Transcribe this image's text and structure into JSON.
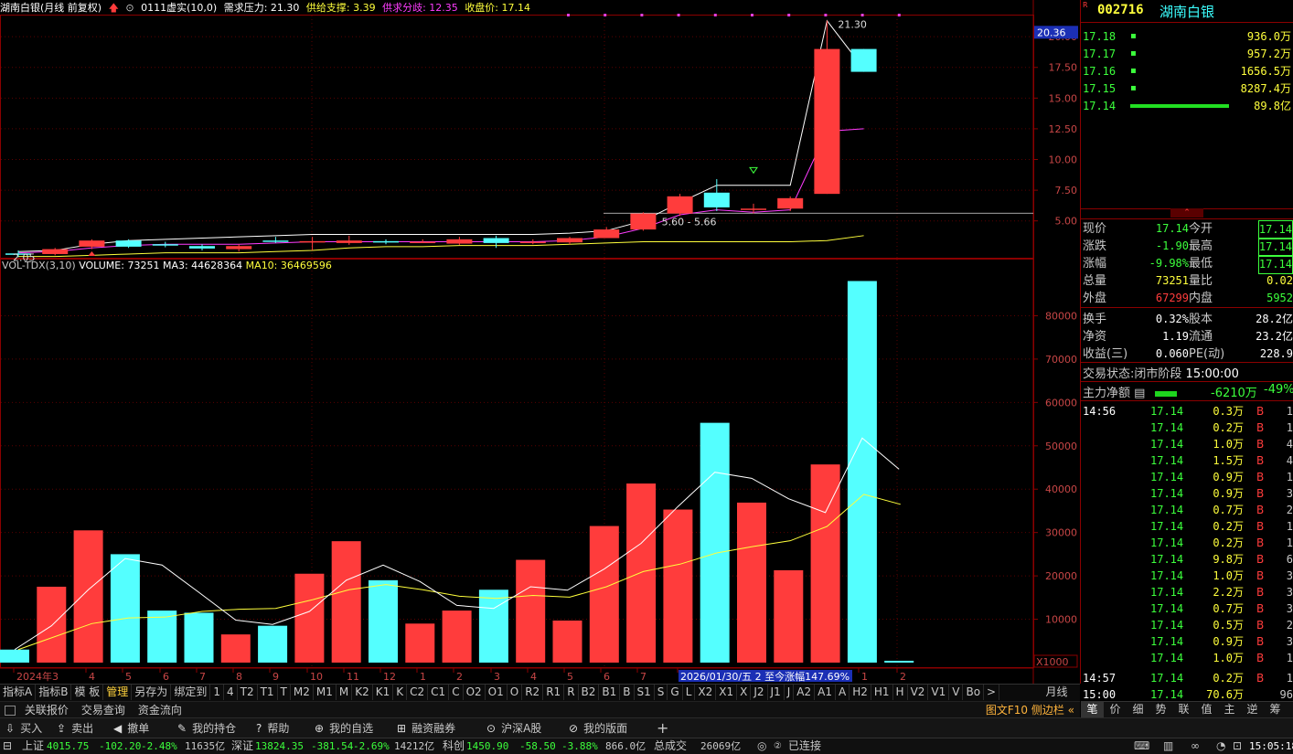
{
  "header": {
    "title": "湖南白银(月线 前复权)",
    "indicator": "0111虚实(10,0)",
    "demand_label": "需求压力: 21.30",
    "supply_label": "供给支撑: 3.39",
    "divergence_label": "供求分歧: 12.35",
    "close_label": "收盘价: 17.14"
  },
  "volume_header": {
    "name": "VOL-TDX(3,10)",
    "volume": "VOLUME: 73251",
    "ma3": "MA3: 44628364",
    "ma10": "MA10: 36469596"
  },
  "price_axis": [
    "20.00",
    "17.50",
    "15.00",
    "12.50",
    "10.00",
    "7.50",
    "5.00"
  ],
  "price_current": "20.36",
  "volume_axis": [
    "80000",
    "70000",
    "60000",
    "50000",
    "40000",
    "30000",
    "20000",
    "10000"
  ],
  "volume_unit": "X1000",
  "annotations": {
    "high_label": "21.30",
    "low_label": "2.05",
    "range_label": "5.60 - 5.66"
  },
  "chart_data": {
    "type": "candlestick",
    "months": [
      "2024-03",
      "2024-04",
      "2024-05",
      "2024-06",
      "2024-07",
      "2024-08",
      "2024-09",
      "2024-10",
      "2024-11",
      "2024-12",
      "2025-01",
      "2025-02",
      "2025-03",
      "2025-04",
      "2025-05",
      "2025-06",
      "2025-07",
      "2025-08",
      "2025-09",
      "2025-10",
      "2025-11",
      "2025-12",
      "2026-01",
      "2026-02"
    ],
    "ohlc": [
      [
        2.35,
        2.6,
        2.05,
        2.3
      ],
      [
        2.3,
        2.8,
        2.2,
        2.7
      ],
      [
        2.9,
        3.5,
        2.7,
        3.4
      ],
      [
        3.4,
        3.5,
        2.8,
        2.9
      ],
      [
        3.1,
        3.3,
        2.85,
        3.05
      ],
      [
        2.95,
        3.1,
        2.6,
        2.75
      ],
      [
        2.7,
        3.1,
        2.5,
        2.95
      ],
      [
        3.4,
        3.7,
        3.2,
        3.3
      ],
      [
        3.3,
        3.7,
        2.6,
        3.35
      ],
      [
        3.2,
        3.8,
        3.05,
        3.4
      ],
      [
        3.35,
        3.5,
        3.1,
        3.25
      ],
      [
        3.3,
        3.5,
        3.2,
        3.3
      ],
      [
        3.15,
        3.7,
        3.05,
        3.5
      ],
      [
        3.6,
        3.8,
        2.8,
        3.2
      ],
      [
        3.25,
        3.5,
        3.1,
        3.3
      ],
      [
        3.25,
        3.7,
        3.1,
        3.6
      ],
      [
        3.6,
        4.5,
        3.6,
        4.3
      ],
      [
        4.3,
        5.7,
        4.2,
        5.6
      ],
      [
        5.6,
        7.2,
        5.4,
        7.0
      ],
      [
        7.3,
        8.4,
        5.8,
        6.1
      ],
      [
        6.0,
        6.4,
        5.6,
        6.0
      ],
      [
        6.0,
        7.0,
        5.8,
        6.85
      ],
      [
        7.2,
        21.3,
        7.2,
        19.0
      ],
      [
        19.0,
        19.0,
        17.14,
        17.14
      ]
    ],
    "volume": [
      3000,
      17500,
      30500,
      25000,
      12000,
      11500,
      6500,
      8500,
      20500,
      28000,
      19000,
      9000,
      12000,
      16800,
      23700,
      9700,
      31500,
      41300,
      35300,
      55300,
      36900,
      21300,
      45700,
      88000
    ],
    "volume_ma3": [
      3000,
      8500,
      16800,
      24000,
      22500,
      16200,
      9800,
      8800,
      11800,
      19000,
      22500,
      18700,
      13200,
      12500,
      17500,
      16700,
      21600,
      27500,
      36000,
      43900,
      42500,
      37800,
      34600,
      51800,
      44600
    ],
    "volume_ma10": [
      3000,
      6000,
      9000,
      10300,
      10500,
      11800,
      12300,
      12500,
      14500,
      16800,
      18000,
      16800,
      15300,
      14800,
      15500,
      15100,
      17500,
      21000,
      22700,
      25300,
      26800,
      28100,
      31400,
      38800,
      36500
    ],
    "price_ma_white": [
      2.5,
      2.6,
      3.1,
      3.4,
      3.5,
      3.6,
      3.7,
      3.8,
      3.9,
      3.9,
      3.9,
      3.9,
      3.9,
      3.9,
      3.9,
      4.0,
      4.2,
      5.0,
      6.5,
      7.9,
      7.9,
      7.9,
      21.3,
      17.4
    ],
    "price_ma_magenta": [
      2.4,
      2.5,
      2.8,
      3.0,
      3.1,
      3.1,
      3.1,
      3.2,
      3.3,
      3.3,
      3.3,
      3.3,
      3.3,
      3.3,
      3.3,
      3.4,
      3.7,
      4.4,
      5.5,
      5.9,
      5.7,
      5.9,
      12.3,
      12.5
    ],
    "price_ma_yellow": [
      2.1,
      2.1,
      2.2,
      2.3,
      2.4,
      2.4,
      2.4,
      2.5,
      2.6,
      2.8,
      2.9,
      2.9,
      3.0,
      3.0,
      3.0,
      3.1,
      3.2,
      3.3,
      3.3,
      3.3,
      3.3,
      3.3,
      3.4,
      3.8
    ],
    "x_tick_labels": [
      "2024年3",
      "4",
      "5",
      "6",
      "7",
      "8",
      "9",
      "10",
      "11",
      "12",
      "1",
      "2",
      "3",
      "4",
      "5",
      "6",
      "7",
      "2026/01/30/五 2 至今涨幅147.69%",
      "1",
      "2"
    ],
    "price_ylim": [
      2,
      21.5
    ],
    "volume_ylim": [
      0,
      90000
    ]
  },
  "right_panel": {
    "code": "002716",
    "name": "湖南白银",
    "orderbook": [
      {
        "price": "17.18",
        "vol": "936.0万"
      },
      {
        "price": "17.17",
        "vol": "957.2万"
      },
      {
        "price": "17.16",
        "vol": "1656.5万"
      },
      {
        "price": "17.15",
        "vol": "8287.4万"
      },
      {
        "price": "17.14",
        "vol": "89.8亿"
      }
    ],
    "quote": [
      {
        "l1": "现价",
        "v1": "17.14",
        "l2": "今开",
        "v2": "17.14"
      },
      {
        "l1": "涨跌",
        "v1": "-1.90",
        "l2": "最高",
        "v2": "17.14"
      },
      {
        "l1": "涨幅",
        "v1": "-9.98%",
        "l2": "最低",
        "v2": "17.14"
      },
      {
        "l1": "总量",
        "v1": "73251",
        "l2": "量比",
        "v2": "0.02"
      },
      {
        "l1": "外盘",
        "v1": "67299",
        "l2": "内盘",
        "v2": "5952"
      },
      {
        "l1": "换手",
        "v1": "0.32%",
        "l2": "股本",
        "v2": "28.2亿"
      },
      {
        "l1": "净资",
        "v1": "1.19",
        "l2": "流通",
        "v2": "23.2亿"
      },
      {
        "l1": "收益(三)",
        "v1": "0.060",
        "l2": "PE(动)",
        "v2": "228.9"
      }
    ],
    "trade_status_label": "交易状态:",
    "trade_status": "闭市阶段",
    "trade_time": "15:00:00",
    "main_flow_label": "主力净额",
    "main_flow": "-6210万",
    "main_flow_pct": "-49%",
    "ticks": [
      {
        "t": "14:56",
        "p": "17.14",
        "v": "0.3万",
        "d": "B",
        "n": "1"
      },
      {
        "t": "",
        "p": "17.14",
        "v": "0.2万",
        "d": "B",
        "n": "1"
      },
      {
        "t": "",
        "p": "17.14",
        "v": "1.0万",
        "d": "B",
        "n": "4"
      },
      {
        "t": "",
        "p": "17.14",
        "v": "1.5万",
        "d": "B",
        "n": "4"
      },
      {
        "t": "",
        "p": "17.14",
        "v": "0.9万",
        "d": "B",
        "n": "1"
      },
      {
        "t": "",
        "p": "17.14",
        "v": "0.9万",
        "d": "B",
        "n": "3"
      },
      {
        "t": "",
        "p": "17.14",
        "v": "0.7万",
        "d": "B",
        "n": "2"
      },
      {
        "t": "",
        "p": "17.14",
        "v": "0.2万",
        "d": "B",
        "n": "1"
      },
      {
        "t": "",
        "p": "17.14",
        "v": "0.2万",
        "d": "B",
        "n": "1"
      },
      {
        "t": "",
        "p": "17.14",
        "v": "9.8万",
        "d": "B",
        "n": "6"
      },
      {
        "t": "",
        "p": "17.14",
        "v": "1.0万",
        "d": "B",
        "n": "3"
      },
      {
        "t": "",
        "p": "17.14",
        "v": "2.2万",
        "d": "B",
        "n": "3"
      },
      {
        "t": "",
        "p": "17.14",
        "v": "0.7万",
        "d": "B",
        "n": "3"
      },
      {
        "t": "",
        "p": "17.14",
        "v": "0.5万",
        "d": "B",
        "n": "2"
      },
      {
        "t": "",
        "p": "17.14",
        "v": "0.9万",
        "d": "B",
        "n": "3"
      },
      {
        "t": "",
        "p": "17.14",
        "v": "1.0万",
        "d": "B",
        "n": "1"
      },
      {
        "t": "14:57",
        "p": "17.14",
        "v": "0.2万",
        "d": "B",
        "n": "1"
      },
      {
        "t": "15:00",
        "p": "17.14",
        "v": "70.6万",
        "d": "",
        "n": "96"
      }
    ],
    "bottom_tabs": [
      "笔",
      "价",
      "细",
      "势",
      "联",
      "值",
      "主",
      "逆",
      "筹"
    ]
  },
  "tabs": [
    "指标A",
    "指标B",
    "模 板",
    "管理",
    "另存为",
    "绑定到",
    "1",
    "4",
    "T2",
    "T1",
    "T",
    "M2",
    "M1",
    "M",
    "K2",
    "K1",
    "K",
    "C2",
    "C1",
    "C",
    "O2",
    "O1",
    "O",
    "R2",
    "R1",
    "R",
    "B2",
    "B1",
    "B",
    "S1",
    "S",
    "G",
    "L",
    "X2",
    "X1",
    "X",
    "J2",
    "J1",
    "J",
    "A2",
    "A1",
    "A",
    "H2",
    "H1",
    "H",
    "V2",
    "V1",
    "V",
    "Bo",
    ">"
  ],
  "tab_period": "月线",
  "menu1": [
    "关联报价",
    "交易查询",
    "资金流向"
  ],
  "menu1_right": "图文F10 侧边栏 «",
  "menu2": [
    "买入",
    "卖出",
    "撤单",
    "我的持仓",
    "帮助",
    "我的自选",
    "融资融券",
    "沪深A股",
    "我的版面"
  ],
  "status": {
    "sh_label": "上证",
    "sh_val": "4015.75",
    "sh_chg": "-102.20",
    "sh_pct": "-2.48%",
    "sh_amt": "11635亿",
    "sz_label": "深证",
    "sz_val": "13824.35",
    "sz_chg": "-381.54",
    "sz_pct": "-2.69%",
    "sz_amt": "14212亿",
    "kc_label": "科创",
    "kc_val": "1450.90",
    "kc_chg": "-58.50",
    "kc_pct": "-3.88%",
    "kc_amt": "866.0亿",
    "total_label": "总成交",
    "total_val": "26069亿",
    "conn": "已连接",
    "time": "15:05:18"
  },
  "colors": {
    "up": "#ff3c3c",
    "down": "#54ffff",
    "ma_white": "#ffffff",
    "ma_magenta": "#ff3cff",
    "ma_yellow": "#ffff3c",
    "border": "#8b0000"
  }
}
